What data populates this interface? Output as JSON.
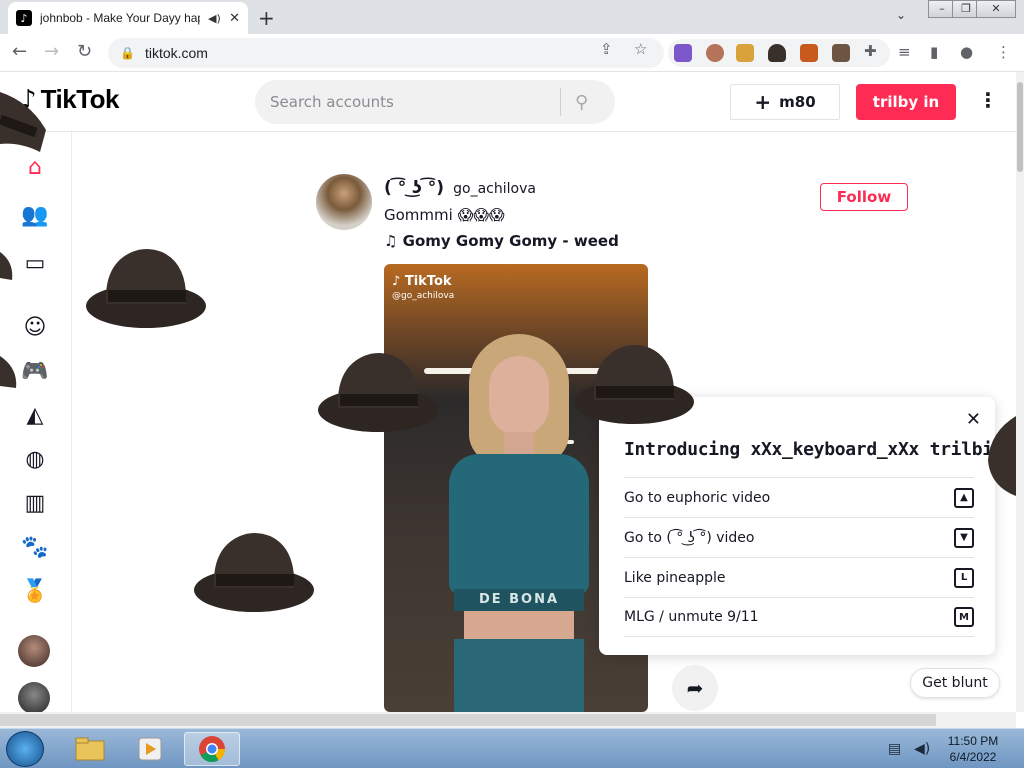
{
  "browser": {
    "tab_title": "johnbob - Make Your Dayy happy",
    "url": "tiktok.com"
  },
  "tiktok": {
    "logo": "TikTok",
    "search_placeholder": "Search accounts",
    "upload_label": "m80",
    "login_label": "trilby in",
    "post": {
      "author_name": "( ͡° ͜ʖ ͡°)",
      "author_handle": "go_achilova",
      "caption": "Gommmi 😱😱😱",
      "music": "♫ Gomy Gomy Gomy - weed",
      "follow_label": "Follow",
      "video_watermark": "TikTok",
      "video_watermark_handle": "@go_achilova",
      "video_shirt_text": "DE BONA"
    },
    "get_blunt_label": "Get blunt"
  },
  "popup": {
    "title": "Introducing xXx_keyboard_xXx trilbies!",
    "rows": [
      {
        "label": "Go to euphoric video",
        "key": "▲"
      },
      {
        "label": "Go to ( ͡° ͜ʖ ͡°) video",
        "key": "▼"
      },
      {
        "label": "Like pineapple",
        "key": "L"
      },
      {
        "label": "MLG / unmute 9/11",
        "key": "M"
      }
    ]
  },
  "taskbar": {
    "time": "11:50 PM",
    "date": "6/4/2022"
  },
  "colors": {
    "brand_red": "#fe2c55",
    "hat": "#3a302b"
  }
}
